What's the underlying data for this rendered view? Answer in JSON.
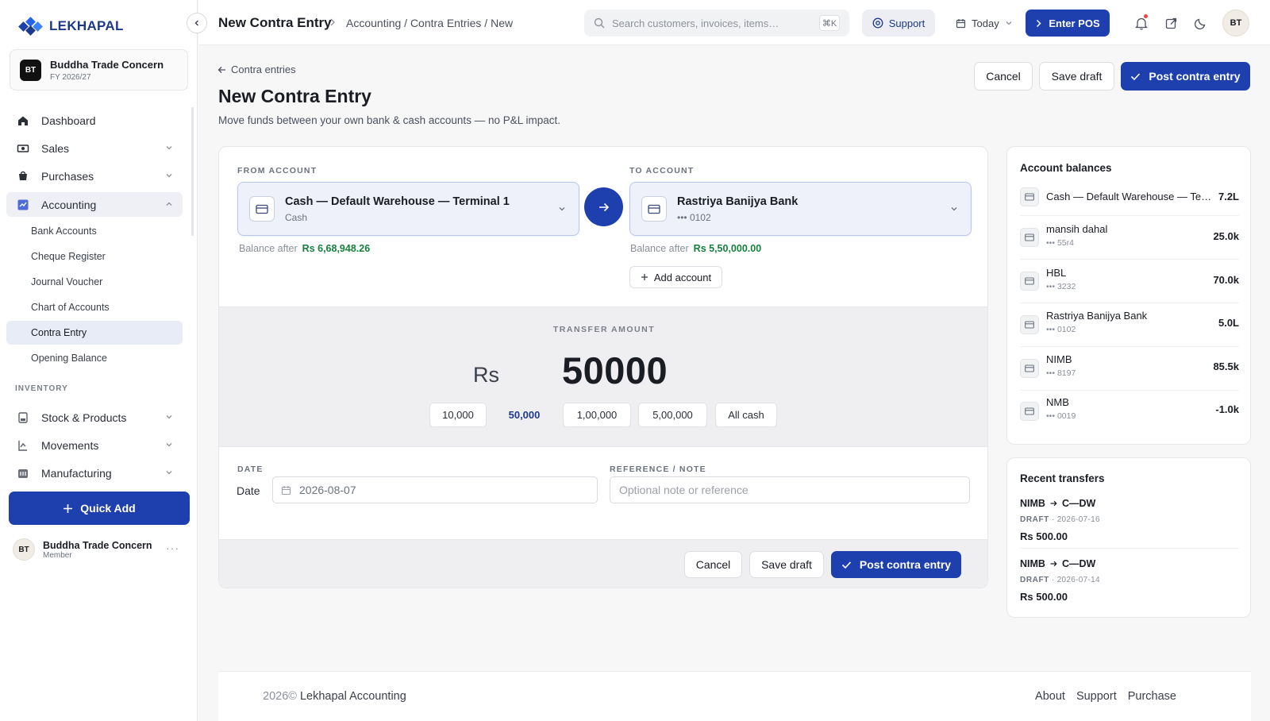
{
  "brand": {
    "name": "LEKHAPAL",
    "color": "#1e40af"
  },
  "organization": {
    "initials": "BT",
    "name": "Buddha Trade Concern",
    "fiscal_year": "FY 2026/27"
  },
  "sidebar": {
    "nav": [
      {
        "label": "Dashboard",
        "icon": "home-icon"
      },
      {
        "label": "Sales",
        "icon": "sales-icon"
      },
      {
        "label": "Purchases",
        "icon": "purchases-icon"
      },
      {
        "label": "Accounting",
        "icon": "accounting-icon"
      }
    ],
    "accounting_sub": [
      {
        "label": "Bank Accounts"
      },
      {
        "label": "Cheque Register"
      },
      {
        "label": "Journal Voucher"
      },
      {
        "label": "Chart of Accounts"
      },
      {
        "label": "Contra Entry"
      },
      {
        "label": "Opening Balance"
      }
    ],
    "inventory_label": "INVENTORY",
    "inventory": [
      {
        "label": "Stock & Products",
        "icon": "box-icon"
      },
      {
        "label": "Movements",
        "icon": "movements-icon"
      },
      {
        "label": "Manufacturing",
        "icon": "factory-icon"
      }
    ],
    "quick_add": "Quick Add",
    "user": {
      "initials": "BT",
      "name": "Buddha Trade Concern",
      "role": "Member",
      "more": "···"
    }
  },
  "topbar": {
    "title": "New Contra Entry",
    "breadcrumb": "Accounting / Contra Entries / New",
    "search_placeholder": "Search customers, invoices, items…",
    "search_shortcut": "⌘K",
    "support": "Support",
    "date_filter": "Today",
    "pos": "Enter POS",
    "avatar": "BT"
  },
  "page": {
    "back": "Contra entries",
    "title": "New Contra Entry",
    "subtitle": "Move funds between your own bank & cash accounts — no P&L impact.",
    "cancel": "Cancel",
    "save_draft": "Save draft",
    "post": "Post contra entry"
  },
  "from": {
    "label": "FROM ACCOUNT",
    "name": "Cash — Default Warehouse — Terminal 1",
    "sub": "Cash",
    "balance_label": "Balance after",
    "balance": "Rs 6,68,948.26"
  },
  "to": {
    "label": "TO ACCOUNT",
    "name": "Rastriya Banijya Bank",
    "sub": "••• 0102",
    "balance_label": "Balance after",
    "balance": "Rs 5,50,000.00",
    "add_account": "Add account"
  },
  "amount": {
    "label": "TRANSFER AMOUNT",
    "currency": "Rs",
    "value": "50000",
    "presets": [
      "10,000",
      "50,000",
      "1,00,000",
      "5,00,000",
      "All cash"
    ],
    "selected_preset": "50,000"
  },
  "form": {
    "date_label": "DATE",
    "date_inline": "Date",
    "date_value": "2026-08-07",
    "note_label": "REFERENCE / NOTE",
    "note_placeholder": "Optional note or reference"
  },
  "balances": {
    "title": "Account balances",
    "items": [
      {
        "name": "Cash — Default Warehouse — Te…",
        "number": "",
        "amount": "7.2L"
      },
      {
        "name": "mansih dahal",
        "number": "••• 55r4",
        "amount": "25.0k"
      },
      {
        "name": "HBL",
        "number": "••• 3232",
        "amount": "70.0k"
      },
      {
        "name": "Rastriya Banijya Bank",
        "number": "••• 0102",
        "amount": "5.0L"
      },
      {
        "name": "NIMB",
        "number": "••• 8197",
        "amount": "85.5k"
      },
      {
        "name": "NMB",
        "number": "••• 0019",
        "amount": "-1.0k"
      }
    ]
  },
  "recent": {
    "title": "Recent transfers",
    "items": [
      {
        "from": "NIMB",
        "to": "C—DW",
        "status": "DRAFT",
        "date": "· 2026-07-16",
        "amount": "Rs 500.00"
      },
      {
        "from": "NIMB",
        "to": "C—DW",
        "status": "DRAFT",
        "date": "· 2026-07-14",
        "amount": "Rs 500.00"
      }
    ]
  },
  "footer": {
    "year": "2026©",
    "company": "Lekhapal Accounting",
    "links": [
      "About",
      "Support",
      "Purchase"
    ]
  }
}
